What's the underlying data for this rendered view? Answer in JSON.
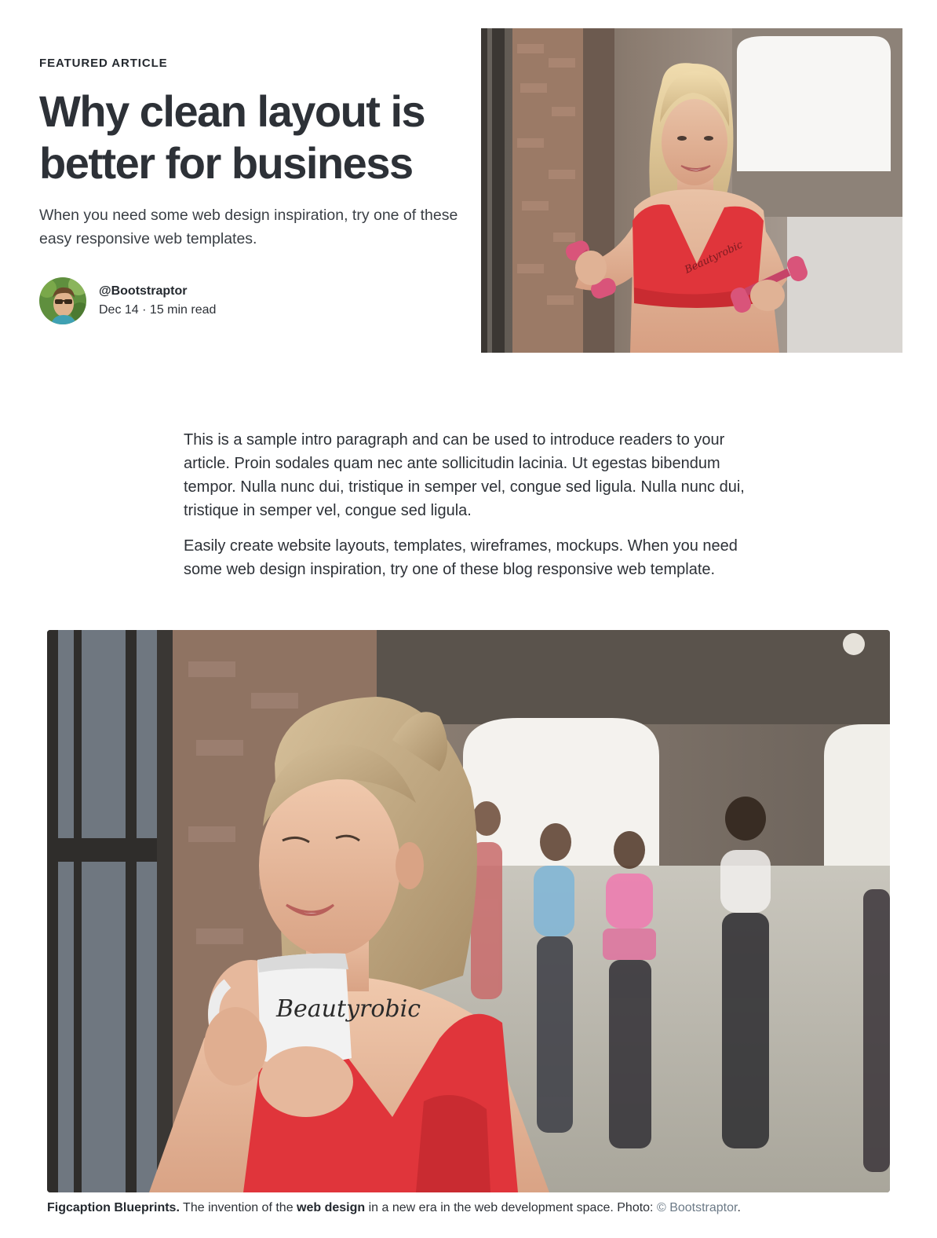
{
  "hero": {
    "eyebrow": "FEATURED ARTICLE",
    "headline": "Why clean layout is better for business",
    "subhead": "When you need some web design inspiration, try one of these easy responsive web templates."
  },
  "author": {
    "handle": "@Bootstraptor",
    "meta": "Dec 14 · 15 min read",
    "avatar_icon": "author-avatar-photo"
  },
  "hero_image": {
    "icon": "fitness-woman-dumbbells-photo",
    "shirt_text": "Beautyrobic"
  },
  "body": {
    "paragraphs": [
      "This is a sample intro paragraph and can be used to introduce readers to your article. Proin sodales quam nec ante sollicitudin lacinia. Ut egestas bibendum tempor. Nulla nunc dui, tristique in semper vel, congue sed ligula. Nulla nunc dui, tristique in semper vel, congue sed ligula.",
      "Easily create website layouts, templates, wireframes, mockups. When you need some web design inspiration, try one of these blog responsive web template."
    ]
  },
  "figure": {
    "icon": "woman-coffee-mug-gym-photo",
    "mug_text": "Beautyrobic",
    "caption_lead": "Figcaption Blueprints.",
    "caption_text_1": " The invention of the ",
    "caption_emphasis": "web design",
    "caption_text_2": " in a new era in the web development space. Photo: ",
    "caption_credit": "© Bootstraptor",
    "caption_end": "."
  },
  "colors": {
    "text": "#2d3137",
    "credit": "#6c7a87",
    "accent_red": "#e0353b"
  }
}
